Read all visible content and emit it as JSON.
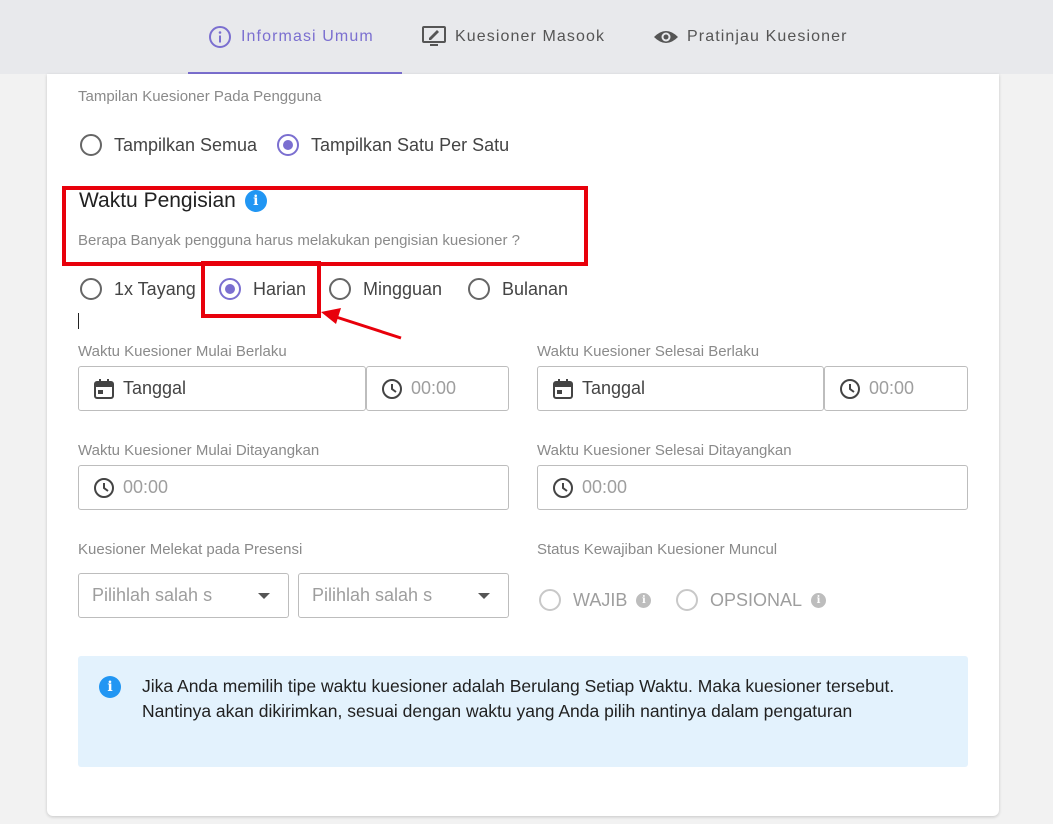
{
  "tabs": [
    {
      "label": "Informasi Umum",
      "icon": "info-circle-icon",
      "active": true
    },
    {
      "label": "Kuesioner Masook",
      "icon": "monitor-edit-icon",
      "active": false
    },
    {
      "label": "Pratinjau Kuesioner",
      "icon": "eye-icon",
      "active": false
    }
  ],
  "display": {
    "label": "Tampilan Kuesioner Pada Pengguna",
    "options": [
      "Tampilkan Semua",
      "Tampilkan Satu Per Satu"
    ],
    "selected": "Tampilkan Satu Per Satu"
  },
  "waktu": {
    "title": "Waktu Pengisian",
    "question": "Berapa Banyak pengguna harus melakukan pengisian kuesioner ?",
    "options": [
      "1x Tayang",
      "Harian",
      "Mingguan",
      "Bulanan"
    ],
    "selected": "Harian"
  },
  "mulai_berlaku": {
    "label": "Waktu Kuesioner Mulai Berlaku",
    "date_placeholder": "Tanggal",
    "time_placeholder": "00:00"
  },
  "selesai_berlaku": {
    "label": "Waktu Kuesioner Selesai Berlaku",
    "date_placeholder": "Tanggal",
    "time_placeholder": "00:00"
  },
  "mulai_ditayangkan": {
    "label": "Waktu Kuesioner Mulai Ditayangkan",
    "time_placeholder": "00:00"
  },
  "selesai_ditayangkan": {
    "label": "Waktu Kuesioner Selesai Ditayangkan",
    "time_placeholder": "00:00"
  },
  "presensi": {
    "label": "Kuesioner Melekat pada Presensi",
    "select1_placeholder": "Pilihlah salah s",
    "select2_placeholder": "Pilihlah salah s"
  },
  "status": {
    "label": "Status Kewajiban Kuesioner Muncul",
    "options": [
      "WAJIB",
      "OPSIONAL"
    ]
  },
  "info": {
    "text": "Jika Anda memilih tipe waktu kuesioner adalah Berulang Setiap Waktu. Maka kuesioner tersebut. Nantinya akan dikirimkan, sesuai dengan waktu yang Anda pilih nantinya dalam pengaturan"
  },
  "colors": {
    "accent": "#7b6fd0",
    "highlight": "#e8000b",
    "info_bg": "#e3f2fd",
    "info_icon": "#2196f3"
  }
}
